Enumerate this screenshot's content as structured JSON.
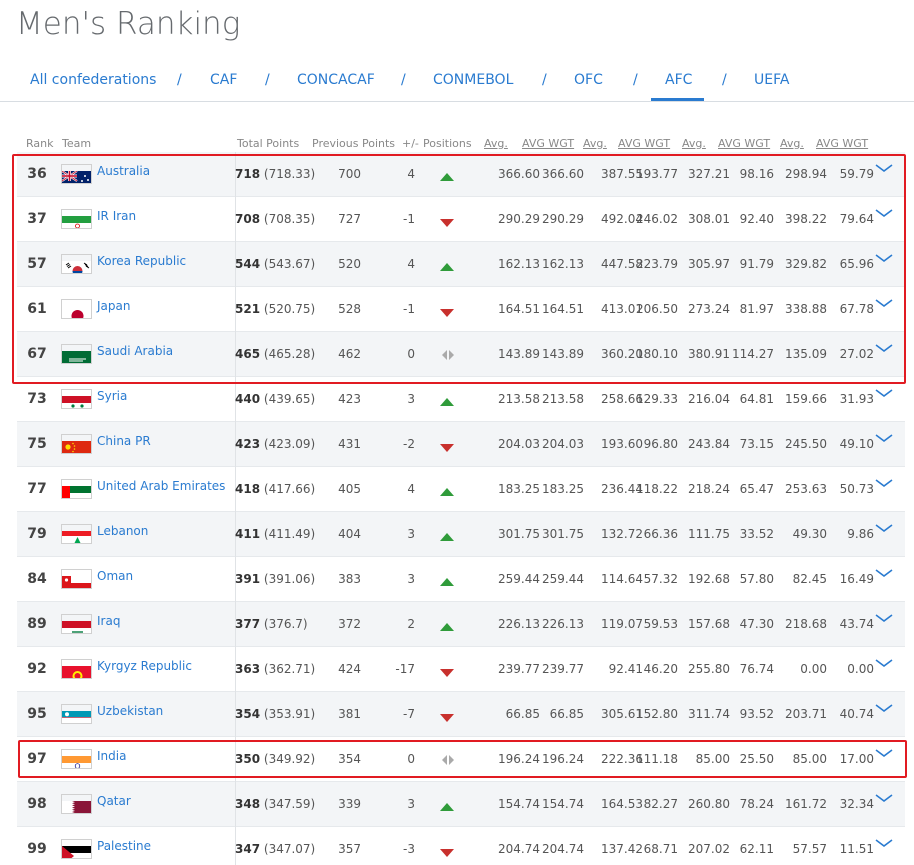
{
  "page": {
    "title": "Men's Ranking"
  },
  "confederations": {
    "tabs": [
      "All confederations",
      "CAF",
      "CONCACAF",
      "CONMEBOL",
      "OFC",
      "AFC",
      "UEFA"
    ],
    "separator": "/",
    "active": "AFC"
  },
  "columns": [
    "Rank",
    "Team",
    "Total Points",
    "Previous Points",
    "+/-",
    "Positions",
    "Avg.",
    "AVG WGT",
    "Avg.",
    "AVG WGT",
    "Avg.",
    "AVG WGT",
    "Avg.",
    "AVG WGT"
  ],
  "colors": {
    "link": "#2a7bd0",
    "up": "#2f9b3a",
    "down": "#c8302d",
    "highlight": "#e11b22"
  },
  "rows": [
    {
      "rank": "36",
      "team": "Australia",
      "flag": "australia-flag",
      "total": "718",
      "total_precise": "(718.33)",
      "previous": "700",
      "diff": "4",
      "trend": "up",
      "v": [
        "366.60",
        "366.60",
        "387.55",
        "193.77",
        "327.21",
        "98.16",
        "298.94",
        "59.79"
      ]
    },
    {
      "rank": "37",
      "team": "IR Iran",
      "flag": "iran-flag",
      "total": "708",
      "total_precise": "(708.35)",
      "previous": "727",
      "diff": "-1",
      "trend": "down",
      "v": [
        "290.29",
        "290.29",
        "492.04",
        "246.02",
        "308.01",
        "92.40",
        "398.22",
        "79.64"
      ]
    },
    {
      "rank": "57",
      "team": "Korea Republic",
      "flag": "korea-flag",
      "total": "544",
      "total_precise": "(543.67)",
      "previous": "520",
      "diff": "4",
      "trend": "up",
      "v": [
        "162.13",
        "162.13",
        "447.58",
        "223.79",
        "305.97",
        "91.79",
        "329.82",
        "65.96"
      ]
    },
    {
      "rank": "61",
      "team": "Japan",
      "flag": "japan-flag",
      "total": "521",
      "total_precise": "(520.75)",
      "previous": "528",
      "diff": "-1",
      "trend": "down",
      "v": [
        "164.51",
        "164.51",
        "413.01",
        "206.50",
        "273.24",
        "81.97",
        "338.88",
        "67.78"
      ]
    },
    {
      "rank": "67",
      "team": "Saudi Arabia",
      "flag": "saudi-flag",
      "total": "465",
      "total_precise": "(465.28)",
      "previous": "462",
      "diff": "0",
      "trend": "same",
      "v": [
        "143.89",
        "143.89",
        "360.20",
        "180.10",
        "380.91",
        "114.27",
        "135.09",
        "27.02"
      ]
    },
    {
      "rank": "73",
      "team": "Syria",
      "flag": "syria-flag",
      "total": "440",
      "total_precise": "(439.65)",
      "previous": "423",
      "diff": "3",
      "trend": "up",
      "v": [
        "213.58",
        "213.58",
        "258.66",
        "129.33",
        "216.04",
        "64.81",
        "159.66",
        "31.93"
      ]
    },
    {
      "rank": "75",
      "team": "China PR",
      "flag": "china-flag",
      "total": "423",
      "total_precise": "(423.09)",
      "previous": "431",
      "diff": "-2",
      "trend": "down",
      "v": [
        "204.03",
        "204.03",
        "193.60",
        "96.80",
        "243.84",
        "73.15",
        "245.50",
        "49.10"
      ]
    },
    {
      "rank": "77",
      "team": "United Arab Emirates",
      "flag": "uae-flag",
      "total": "418",
      "total_precise": "(417.66)",
      "previous": "405",
      "diff": "4",
      "trend": "up",
      "v": [
        "183.25",
        "183.25",
        "236.44",
        "118.22",
        "218.24",
        "65.47",
        "253.63",
        "50.73"
      ]
    },
    {
      "rank": "79",
      "team": "Lebanon",
      "flag": "lebanon-flag",
      "total": "411",
      "total_precise": "(411.49)",
      "previous": "404",
      "diff": "3",
      "trend": "up",
      "v": [
        "301.75",
        "301.75",
        "132.72",
        "66.36",
        "111.75",
        "33.52",
        "49.30",
        "9.86"
      ]
    },
    {
      "rank": "84",
      "team": "Oman",
      "flag": "oman-flag",
      "total": "391",
      "total_precise": "(391.06)",
      "previous": "383",
      "diff": "3",
      "trend": "up",
      "v": [
        "259.44",
        "259.44",
        "114.64",
        "57.32",
        "192.68",
        "57.80",
        "82.45",
        "16.49"
      ]
    },
    {
      "rank": "89",
      "team": "Iraq",
      "flag": "iraq-flag",
      "total": "377",
      "total_precise": "(376.7)",
      "previous": "372",
      "diff": "2",
      "trend": "up",
      "v": [
        "226.13",
        "226.13",
        "119.07",
        "59.53",
        "157.68",
        "47.30",
        "218.68",
        "43.74"
      ]
    },
    {
      "rank": "92",
      "team": "Kyrgyz Republic",
      "flag": "kyrgyz-flag",
      "total": "363",
      "total_precise": "(362.71)",
      "previous": "424",
      "diff": "-17",
      "trend": "down",
      "v": [
        "239.77",
        "239.77",
        "92.41",
        "46.20",
        "255.80",
        "76.74",
        "0.00",
        "0.00"
      ]
    },
    {
      "rank": "95",
      "team": "Uzbekistan",
      "flag": "uzbekistan-flag",
      "total": "354",
      "total_precise": "(353.91)",
      "previous": "381",
      "diff": "-7",
      "trend": "down",
      "v": [
        "66.85",
        "66.85",
        "305.61",
        "152.80",
        "311.74",
        "93.52",
        "203.71",
        "40.74"
      ]
    },
    {
      "rank": "97",
      "team": "India",
      "flag": "india-flag",
      "total": "350",
      "total_precise": "(349.92)",
      "previous": "354",
      "diff": "0",
      "trend": "same",
      "v": [
        "196.24",
        "196.24",
        "222.36",
        "111.18",
        "85.00",
        "25.50",
        "85.00",
        "17.00"
      ]
    },
    {
      "rank": "98",
      "team": "Qatar",
      "flag": "qatar-flag",
      "total": "348",
      "total_precise": "(347.59)",
      "previous": "339",
      "diff": "3",
      "trend": "up",
      "v": [
        "154.74",
        "154.74",
        "164.53",
        "82.27",
        "260.80",
        "78.24",
        "161.72",
        "32.34"
      ]
    },
    {
      "rank": "99",
      "team": "Palestine",
      "flag": "palestine-flag",
      "total": "347",
      "total_precise": "(347.07)",
      "previous": "357",
      "diff": "-3",
      "trend": "down",
      "v": [
        "204.74",
        "204.74",
        "137.42",
        "68.71",
        "207.02",
        "62.11",
        "57.57",
        "11.51"
      ]
    }
  ]
}
